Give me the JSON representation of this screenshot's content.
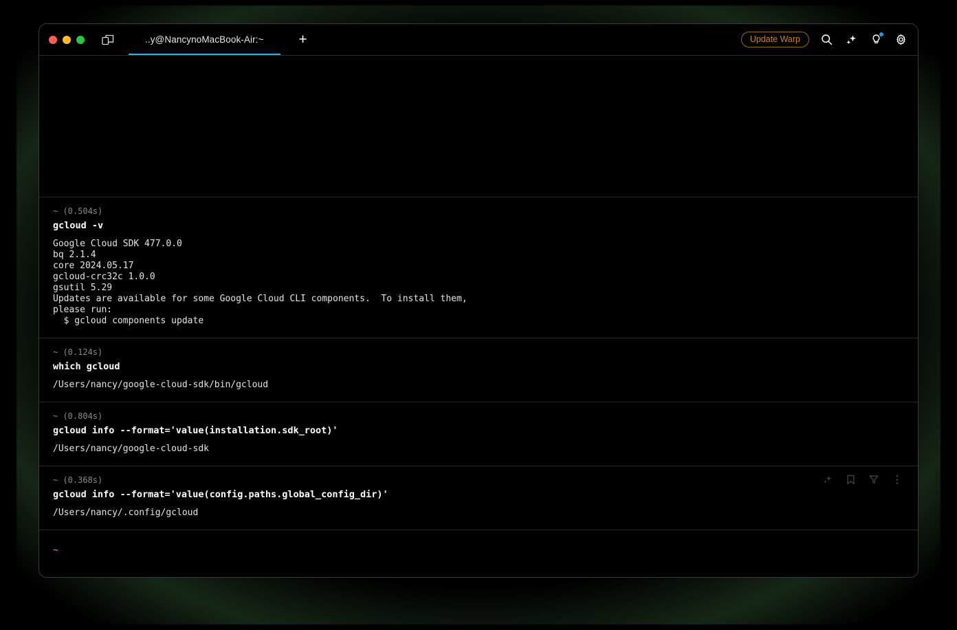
{
  "window": {
    "traffic_lights": [
      "close",
      "minimize",
      "zoom"
    ],
    "panel_toggle_icon": "split-panel-icon",
    "tab_title": "..y@NancynoMacBook-Air:~",
    "new_tab_label": "+",
    "update_button_label": "Update Warp",
    "right_icons": [
      "search-icon",
      "sparkle-ai-icon",
      "lightbulb-icon",
      "gear-icon"
    ],
    "accent_tab_color": "#2bb3e8",
    "update_button_color": "#c9881c",
    "notification_dot_color": "#1e9bf0"
  },
  "blocks": [
    {
      "prompt": "~ (0.504s)",
      "command": "gcloud -v",
      "output": "Google Cloud SDK 477.0.0\nbq 2.1.4\ncore 2024.05.17\ngcloud-crc32c 1.0.0\ngsutil 5.29\nUpdates are available for some Google Cloud CLI components.  To install them,\nplease run:\n  $ gcloud components update"
    },
    {
      "prompt": "~ (0.124s)",
      "command": "which gcloud",
      "output": "/Users/nancy/google-cloud-sdk/bin/gcloud"
    },
    {
      "prompt": "~ (0.804s)",
      "command": "gcloud info --format='value(installation.sdk_root)'",
      "output": "/Users/nancy/google-cloud-sdk"
    },
    {
      "prompt": "~ (0.368s)",
      "command": "gcloud info --format='value(config.paths.global_config_dir)'",
      "output": "/Users/nancy/.config/gcloud",
      "actions": [
        "sparkle-ai-icon",
        "bookmark-icon",
        "filter-icon",
        "more-options-icon"
      ]
    }
  ],
  "final_block": {
    "prompt_symbol": "~",
    "prompt_color": "#e050c8"
  }
}
